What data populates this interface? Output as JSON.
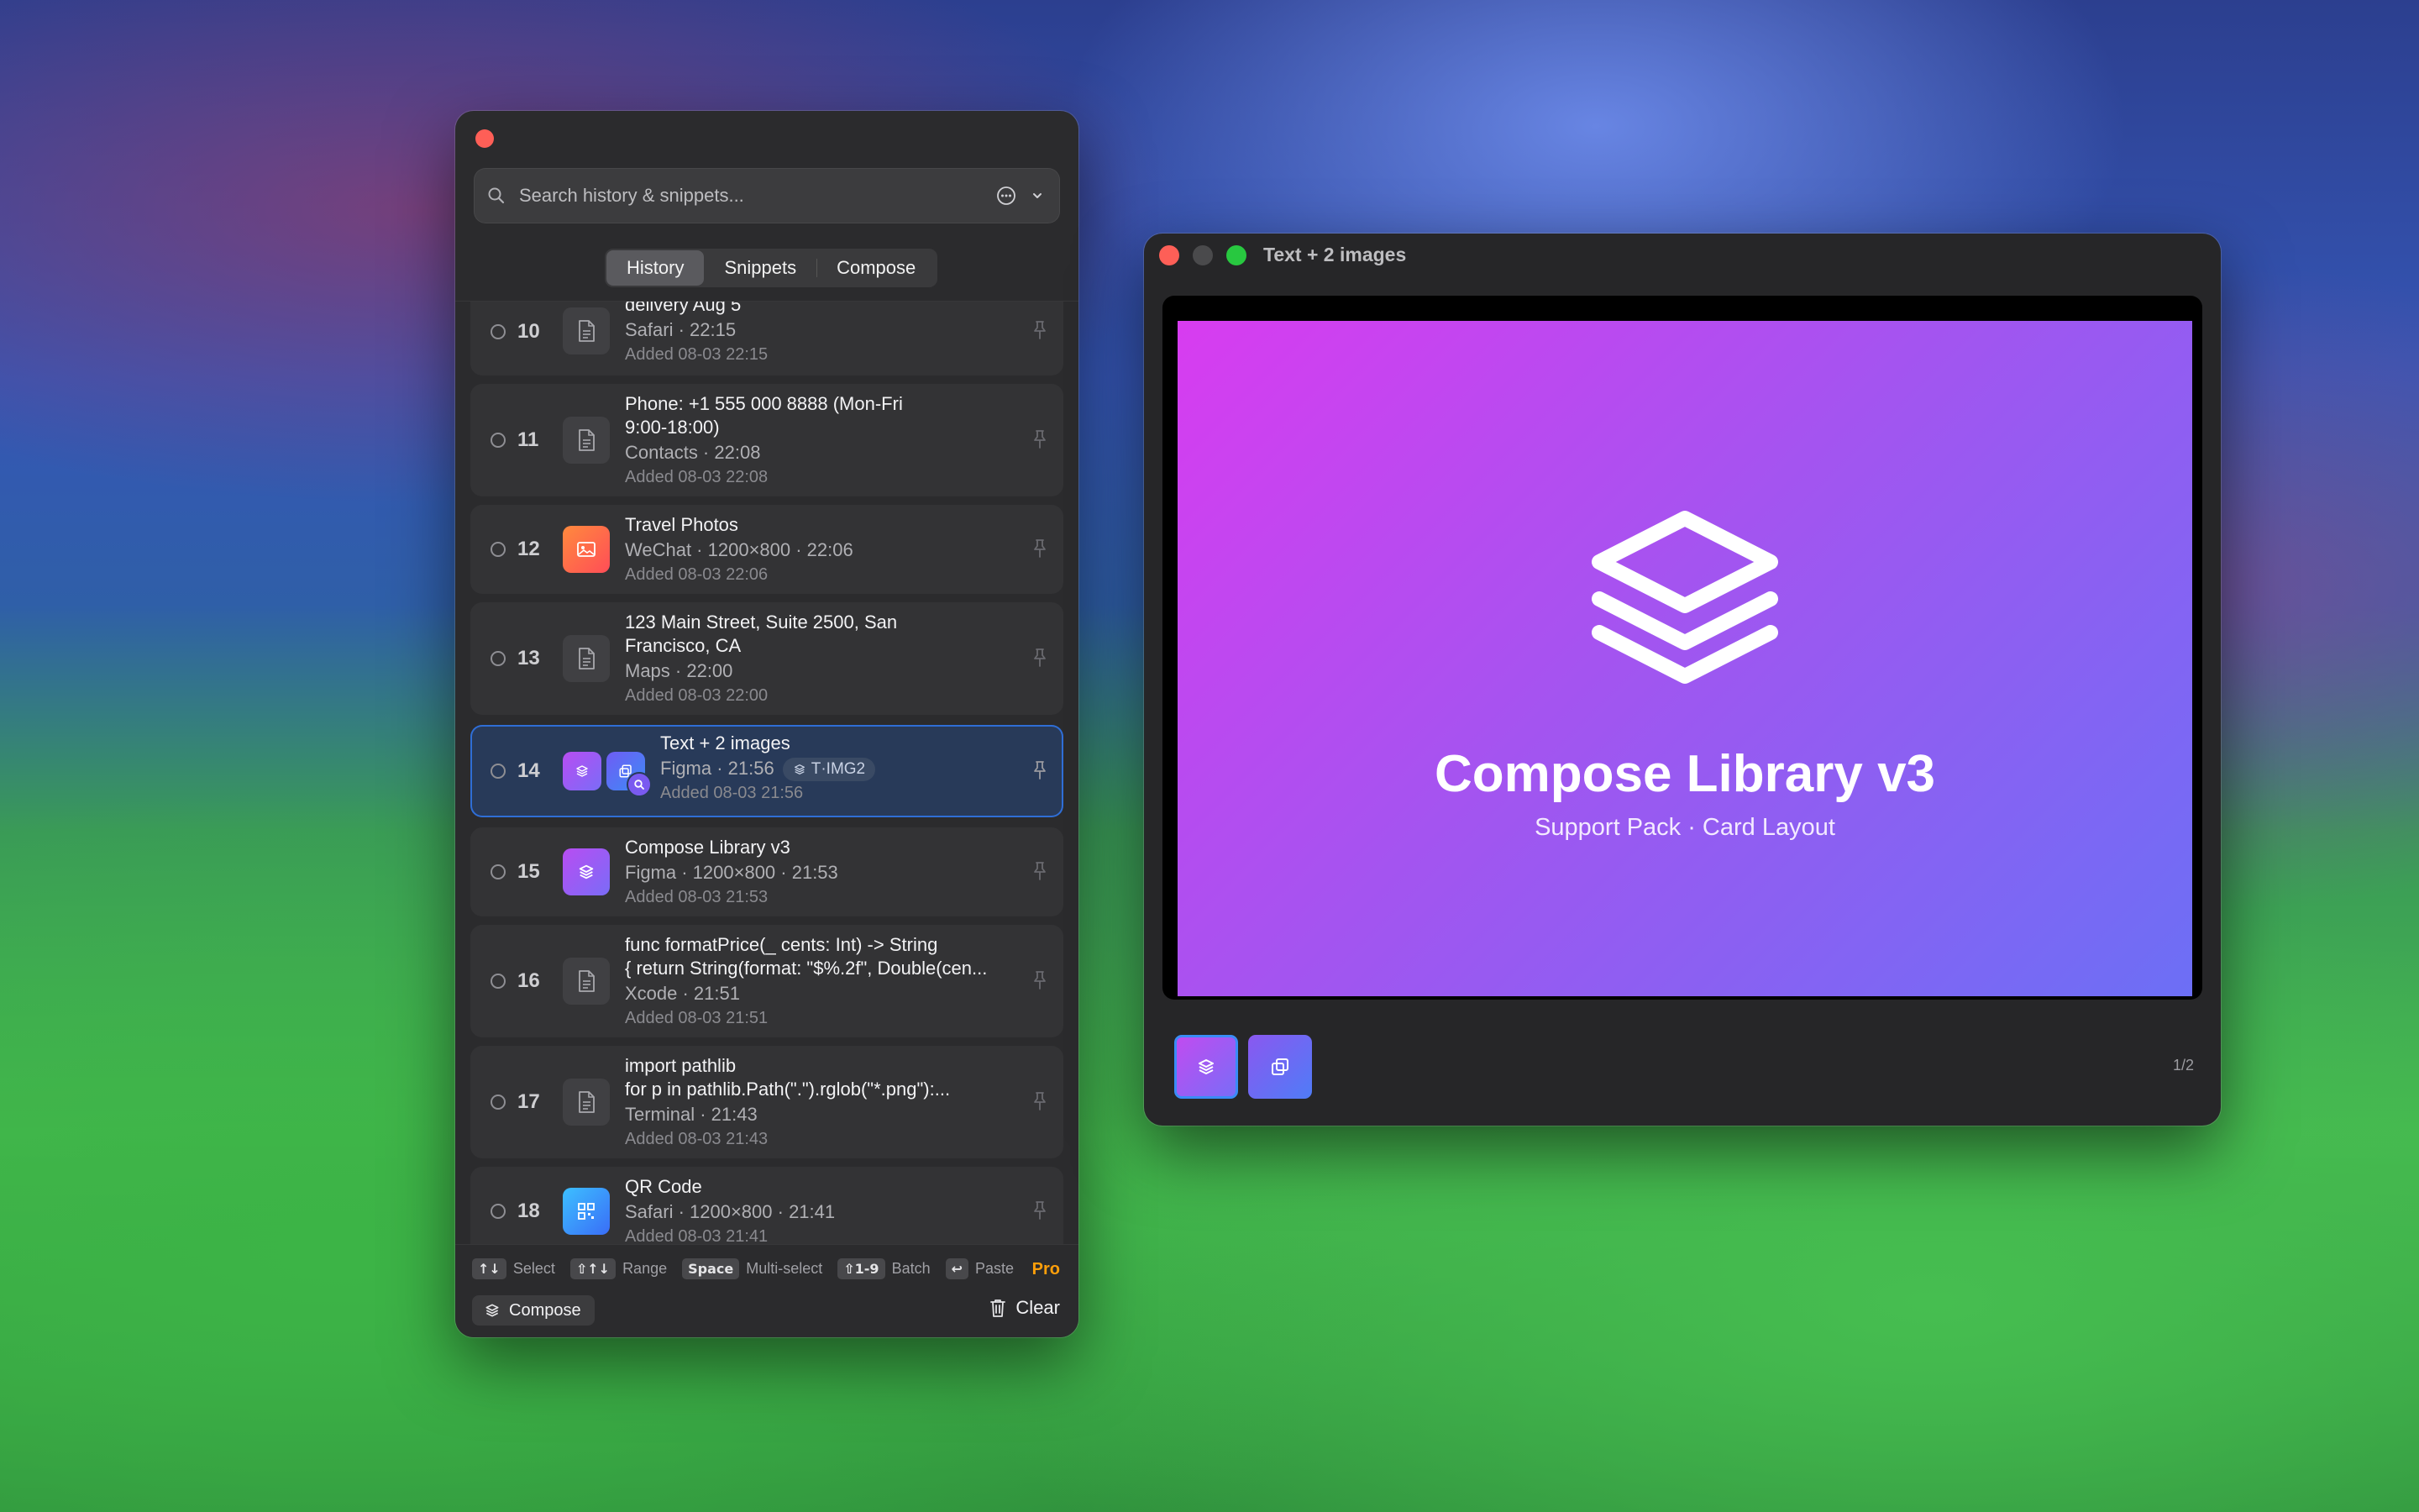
{
  "panel": {
    "search_placeholder": "Search history & snippets...",
    "tabs": [
      {
        "label": "History",
        "active": true
      },
      {
        "label": "Snippets",
        "active": false
      },
      {
        "label": "Compose",
        "active": false
      }
    ],
    "items": [
      {
        "num": "10",
        "title": "delivery Aug 5",
        "sub": "Safari · 22:15",
        "added": "Added 08-03 22:15",
        "thumb": "document-icon"
      },
      {
        "num": "11",
        "title": "Phone: +1 555 000 8888 (Mon-Fri 9:00-18:00)",
        "sub": "Contacts · 22:08",
        "added": "Added 08-03 22:08",
        "thumb": "document-icon"
      },
      {
        "num": "12",
        "title": "Travel Photos",
        "sub": "WeChat · 1200×800 · 22:06",
        "added": "Added 08-03 22:06",
        "thumb": "image-thumbnail"
      },
      {
        "num": "13",
        "title": "123 Main Street, Suite 2500, San Francisco, CA",
        "sub": "Maps · 22:00",
        "added": "Added 08-03 22:00",
        "thumb": "document-icon"
      },
      {
        "num": "14",
        "title": "Text + 2 images",
        "sub": "Figma · 21:56",
        "tag": "T·IMG2",
        "added": "Added 08-03 21:56",
        "thumb": "compose-thumbnail",
        "selected": true
      },
      {
        "num": "15",
        "title": "Compose Library v3",
        "sub": "Figma · 1200×800 · 21:53",
        "added": "Added 08-03 21:53",
        "thumb": "image-thumbnail"
      },
      {
        "num": "16",
        "title": "func formatPrice(_ cents: Int) -> String",
        "title2": "{ return String(format: \"$%.2f\", Double(cen...",
        "sub": "Xcode · 21:51",
        "added": "Added 08-03 21:51",
        "thumb": "document-icon"
      },
      {
        "num": "17",
        "title": "import pathlib",
        "title2": "for p in pathlib.Path(\".\").rglob(\"*.png\"):...",
        "sub": "Terminal · 21:43",
        "added": "Added 08-03 21:43",
        "thumb": "document-icon"
      },
      {
        "num": "18",
        "title": "QR Code",
        "sub": "Safari · 1200×800 · 21:41",
        "added": "Added 08-03 21:41",
        "thumb": "qr-thumbnail"
      }
    ],
    "hints": [
      {
        "key": "↑↓",
        "label": "Select"
      },
      {
        "key": "⇧↑↓",
        "label": "Range"
      },
      {
        "key": "Space",
        "label": "Multi-select"
      },
      {
        "key": "⇧1-9",
        "label": "Batch"
      },
      {
        "key": "↩",
        "label": "Paste"
      }
    ],
    "pro_label": "Pro",
    "compose_label": "Compose",
    "clear_label": "Clear"
  },
  "preview": {
    "window_title": "Text + 2 images",
    "slide_title": "Compose Library v3",
    "slide_subtitle": "Support Pack · Card Layout",
    "counter": "1/2"
  },
  "colors": {
    "accent": "#2f6ed6",
    "pro": "#ff9f0a",
    "slide_gradient_start": "#d83cf0",
    "slide_gradient_end": "#6c6ff5"
  }
}
